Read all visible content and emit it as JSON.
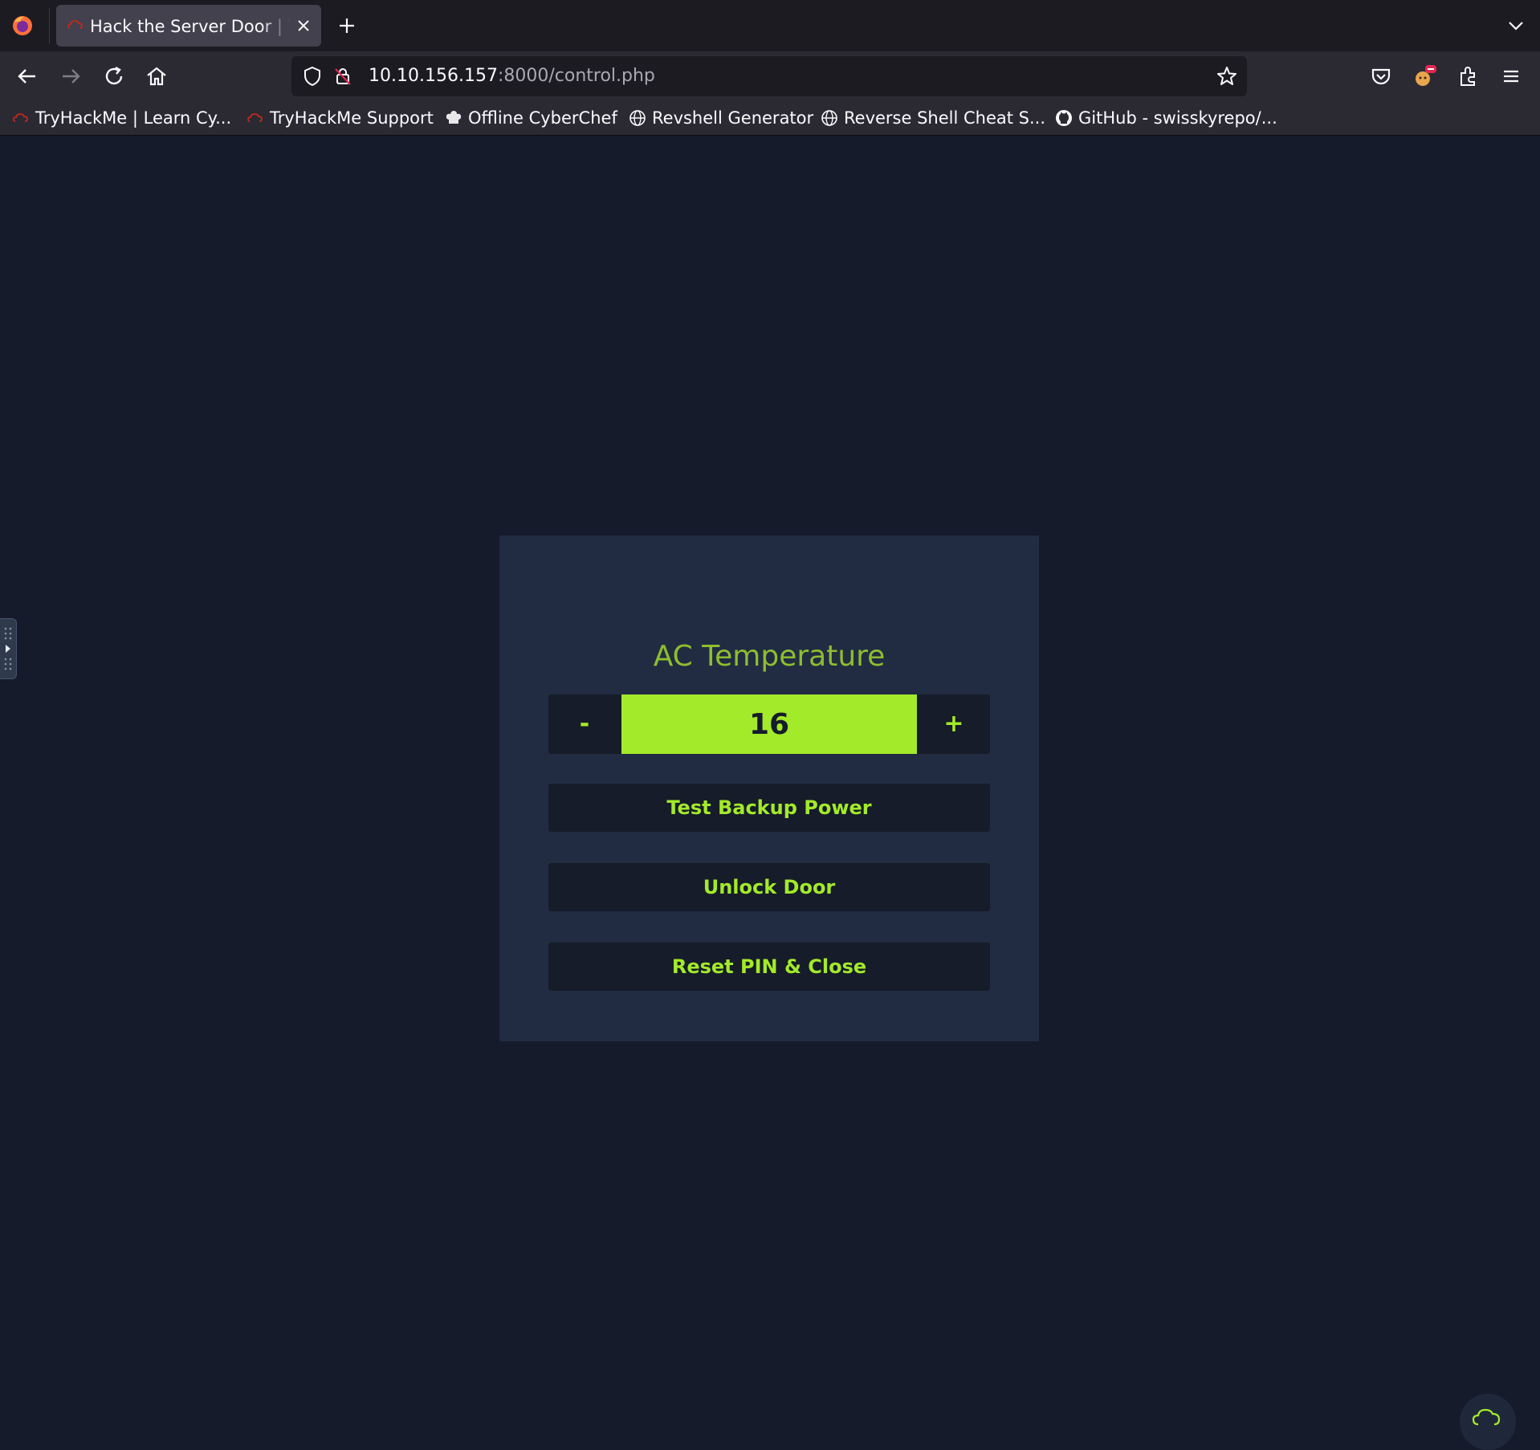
{
  "browser": {
    "tab": {
      "title": "Hack the Server Door | TryHackMe"
    },
    "url": {
      "host": "10.10.156.157",
      "path": ":8000/control.php"
    },
    "bookmarks": [
      {
        "label": "TryHackMe | Learn Cy...",
        "icon": "tryhackme-icon"
      },
      {
        "label": "TryHackMe Support",
        "icon": "tryhackme-icon"
      },
      {
        "label": "Offline CyberChef",
        "icon": "chef-hat-icon"
      },
      {
        "label": "Revshell Generator",
        "icon": "globe-icon"
      },
      {
        "label": "Reverse Shell Cheat S...",
        "icon": "globe-icon"
      },
      {
        "label": "GitHub - swisskyrepo/...",
        "icon": "github-icon"
      }
    ]
  },
  "panel": {
    "title": "AC Temperature",
    "temperature": {
      "decrease_label": "-",
      "value": "16",
      "increase_label": "+"
    },
    "buttons": {
      "backup_power": "Test Backup Power",
      "unlock_door": "Unlock Door",
      "reset_pin": "Reset PIN & Close"
    }
  },
  "colors": {
    "page_bg": "#151b2b",
    "panel_bg": "#212c42",
    "accent": "#a3ea2a",
    "title": "#8fbd2f"
  }
}
